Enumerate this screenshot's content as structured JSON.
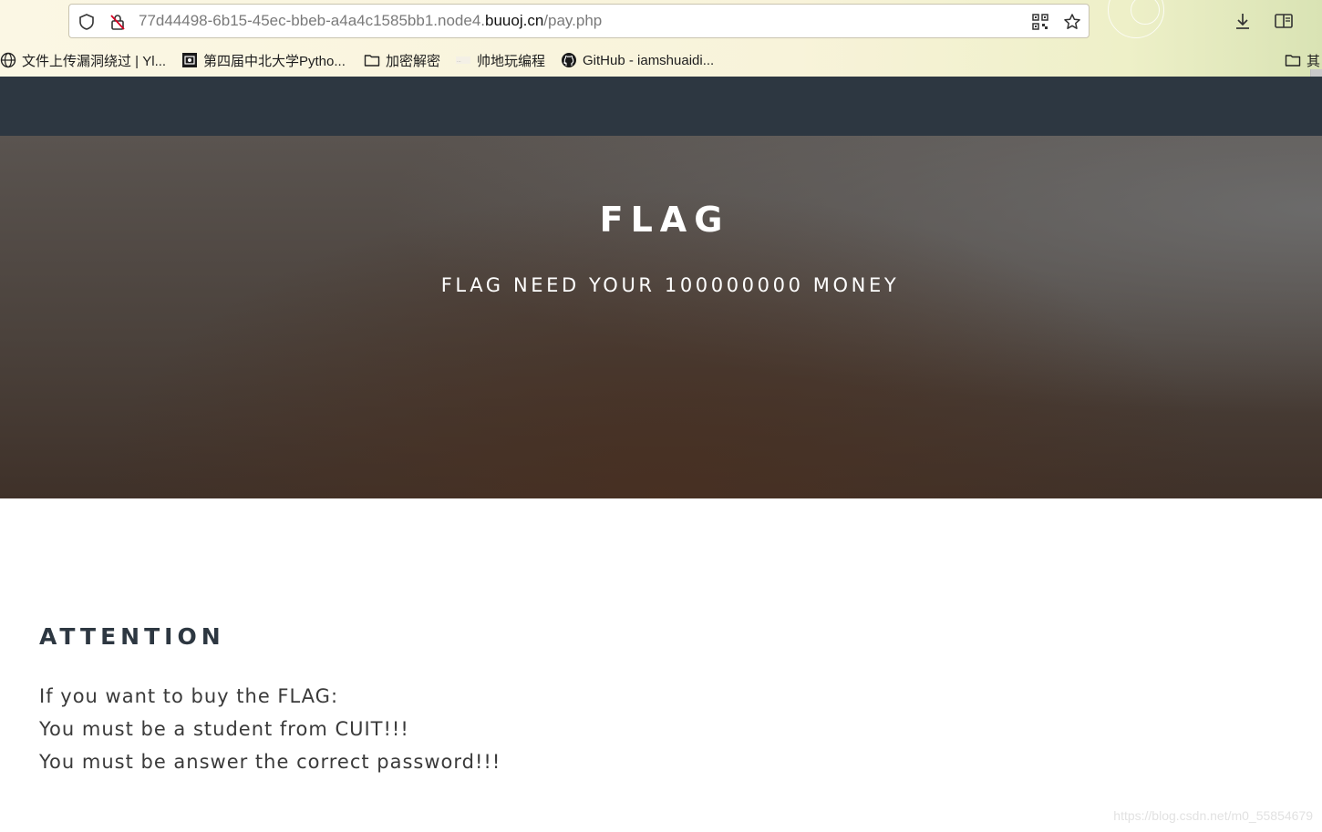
{
  "browser": {
    "url_prefix": "77d44498-6b15-45ec-bbeb-a4a4c1585bb1.node4.",
    "url_host": "buuoj.cn",
    "url_path": "/pay.php",
    "bookmarks": [
      {
        "label": "文件上传漏洞绕过 | Yl...",
        "icon": "globe-icon"
      },
      {
        "label": "第四届中北大学Pytho...",
        "icon": "site-logo-icon"
      },
      {
        "label": "加密解密",
        "icon": "folder-icon"
      },
      {
        "label": "帅地玩编程",
        "icon": "site-logo-icon"
      },
      {
        "label": "GitHub - iamshuaidi...",
        "icon": "github-icon"
      },
      {
        "label": "其",
        "icon": "folder-icon"
      }
    ]
  },
  "hero": {
    "title": "FLAG",
    "subtitle": "FLAG NEED YOUR 100000000 MONEY"
  },
  "attention": {
    "heading": "ATTENTION",
    "lines": [
      "If you want to buy the FLAG:",
      "You must be a student from CUIT!!!",
      "You must be answer the correct password!!!"
    ]
  },
  "watermark": "https://blog.csdn.net/m0_55854679",
  "colors": {
    "navbar": "#2d3741",
    "heading": "#2d3741",
    "body_text": "#3a3a3a"
  }
}
